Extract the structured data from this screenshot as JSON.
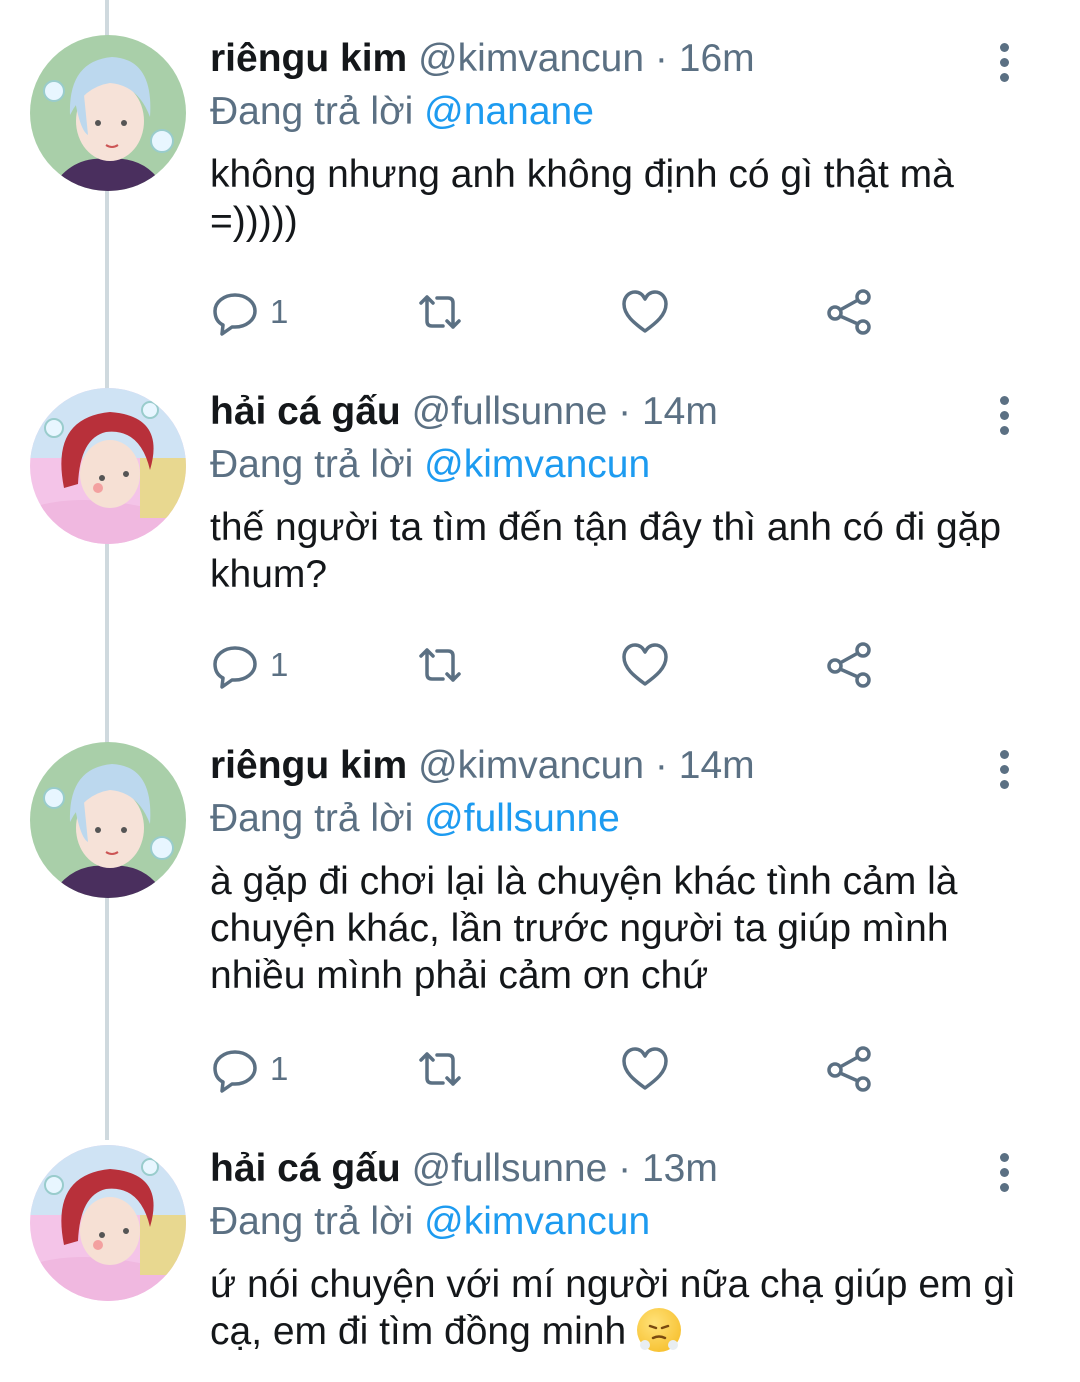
{
  "tweets": [
    {
      "name": "riêngu kim",
      "handle": "@kimvancun",
      "sep": "·",
      "time": "16m",
      "reply_prefix": "Đang trả lời",
      "reply_to": "@nanane",
      "text": "không nhưng anh không định có gì thật mà =)))))",
      "reply_count": "1",
      "avatar": "blue-hair-avatar"
    },
    {
      "name": "hải cá gấu",
      "handle": "@fullsunne",
      "sep": "·",
      "time": "14m",
      "reply_prefix": "Đang trả lời",
      "reply_to": "@kimvancun",
      "text": "thế người ta tìm đến tận đây thì anh có đi gặp khum?",
      "reply_count": "1",
      "avatar": "red-hair-avatar"
    },
    {
      "name": "riêngu kim",
      "handle": "@kimvancun",
      "sep": "·",
      "time": "14m",
      "reply_prefix": "Đang trả lời",
      "reply_to": "@fullsunne",
      "text": "à gặp đi chơi lại là chuyện khác tình cảm là chuyện khác, lần trước người ta giúp mình nhiều mình phải cảm ơn chứ",
      "reply_count": "1",
      "avatar": "blue-hair-avatar"
    },
    {
      "name": "hải cá gấu",
      "handle": "@fullsunne",
      "sep": "·",
      "time": "13m",
      "reply_prefix": "Đang trả lời",
      "reply_to": "@kimvancun",
      "text": "ứ nói chuyện với mí người nữa chạ giúp em gì cạ, em đi tìm đồng minh",
      "emoji": "face-with-steam-emoji",
      "avatar": "red-hair-avatar"
    }
  ],
  "colors": {
    "accent": "#1d9bf0",
    "secondary_text": "#5b7083",
    "thread_line": "#cfd9de"
  },
  "icons": [
    "reply-icon",
    "retweet-icon",
    "like-icon",
    "share-icon",
    "more-icon"
  ]
}
